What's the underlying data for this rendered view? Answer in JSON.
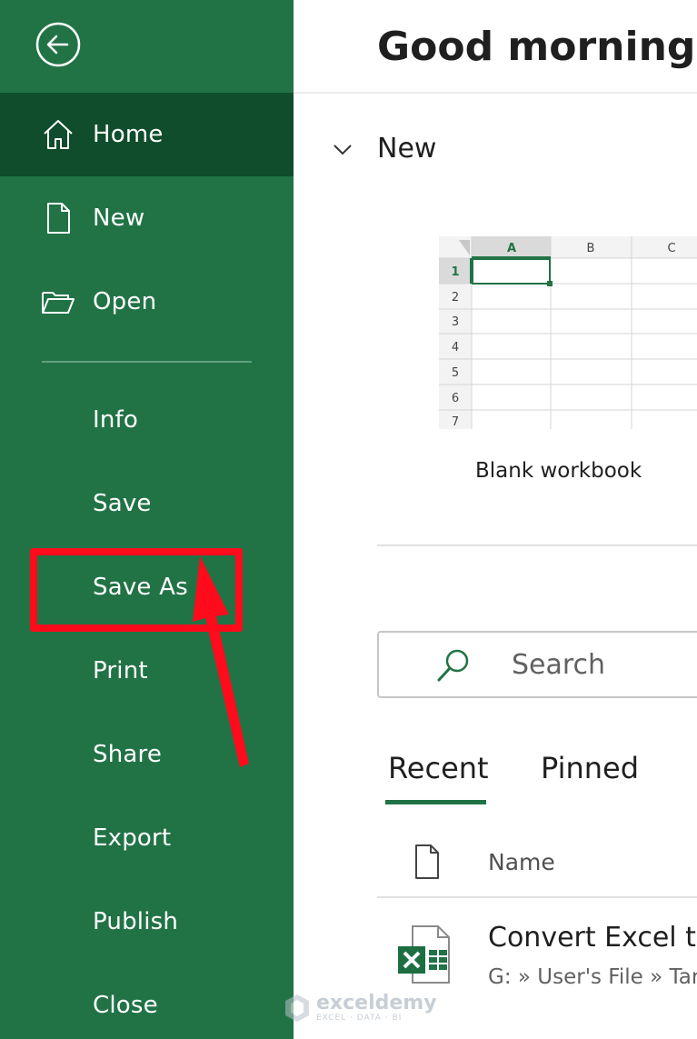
{
  "sidebar": {
    "items": [
      {
        "id": "home",
        "label": "Home",
        "icon": "home-icon",
        "active": true
      },
      {
        "id": "new",
        "label": "New",
        "icon": "new-document-icon"
      },
      {
        "id": "open",
        "label": "Open",
        "icon": "folder-open-icon"
      },
      {
        "id": "info",
        "label": "Info"
      },
      {
        "id": "save",
        "label": "Save"
      },
      {
        "id": "save-as",
        "label": "Save As"
      },
      {
        "id": "print",
        "label": "Print"
      },
      {
        "id": "share",
        "label": "Share"
      },
      {
        "id": "export",
        "label": "Export"
      },
      {
        "id": "publish",
        "label": "Publish"
      },
      {
        "id": "close",
        "label": "Close"
      }
    ]
  },
  "main": {
    "greeting": "Good morning",
    "new_section": {
      "title": "New",
      "template": {
        "label": "Blank workbook",
        "columns": [
          "A",
          "B",
          "C"
        ],
        "rows": [
          "1",
          "2",
          "3",
          "4",
          "5",
          "6",
          "7"
        ]
      }
    },
    "search": {
      "placeholder": "Search"
    },
    "tabs": [
      {
        "label": "Recent",
        "active": true
      },
      {
        "label": "Pinned"
      }
    ],
    "file_list": {
      "column_name": "Name",
      "files": [
        {
          "name": "Convert Excel to",
          "path": "G: » User's File » Tar",
          "icon": "excel-file-icon"
        }
      ]
    }
  },
  "watermark": {
    "text": "exceldemy",
    "subtext": "EXCEL · DATA · BI"
  },
  "colors": {
    "sidebar_bg": "#217346",
    "sidebar_active": "#0f4d2c",
    "accent": "#217346",
    "annotation": "#ff0b1c"
  }
}
